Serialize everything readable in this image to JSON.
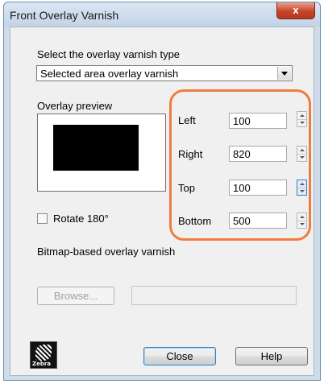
{
  "window": {
    "title": "Front Overlay Varnish",
    "close_glyph": "x"
  },
  "varnish_type": {
    "label": "Select the overlay varnish type",
    "selected": "Selected area overlay varnish"
  },
  "preview": {
    "label": "Overlay preview"
  },
  "rotate": {
    "label": "Rotate 180°",
    "checked": false
  },
  "coordinates": {
    "left": {
      "label": "Left",
      "value": "100"
    },
    "right": {
      "label": "Right",
      "value": "820"
    },
    "top": {
      "label": "Top",
      "value": "100"
    },
    "bottom": {
      "label": "Bottom",
      "value": "500"
    }
  },
  "bitmap": {
    "label": "Bitmap-based overlay varnish",
    "browse_label": "Browse...",
    "path": ""
  },
  "footer": {
    "close_label": "Close",
    "help_label": "Help",
    "logo_text": "Zebra"
  },
  "colors": {
    "highlight": "#ee7d40",
    "window_frame": "#cfdbe9",
    "client_bg": "#f0f0f0"
  }
}
